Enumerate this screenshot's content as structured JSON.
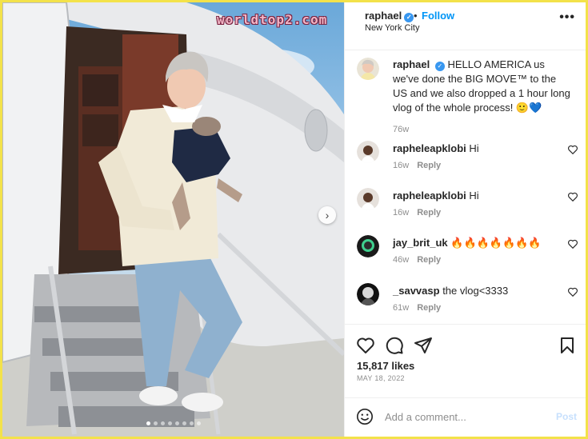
{
  "watermark": "worldtop2.com",
  "carousel": {
    "dot_count": 8,
    "active_index": 0
  },
  "post": {
    "username": "raphael",
    "follow_label": "Follow",
    "separator": "•",
    "location": "New York City",
    "more_label": "•••",
    "caption_username": "raphael",
    "caption_text": "HELLO AMERICA us we've done the BIG MOVE™ to the US and we also dropped a 1 hour long vlog of the whole process! 🙂💙",
    "caption_time": "76w",
    "likes": "15,817 likes",
    "date": "MAY 18, 2022"
  },
  "comments": [
    {
      "user": "rapheleapklobi",
      "text": "Hi",
      "time": "16w",
      "reply": "Reply"
    },
    {
      "user": "rapheleapklobi",
      "text": "Hi",
      "time": "16w",
      "reply": "Reply"
    },
    {
      "user": "jay_brit_uk",
      "text": "🔥🔥🔥🔥🔥🔥🔥",
      "time": "46w",
      "reply": "Reply"
    },
    {
      "user": "_savvasp",
      "text": "the vlog<3333",
      "time": "61w",
      "reply": "Reply"
    }
  ],
  "add_comment": {
    "placeholder": "Add a comment...",
    "post_label": "Post"
  },
  "icons": {
    "more": "more-horizontal-icon",
    "verified": "verified-badge-icon",
    "like": "heart-icon",
    "comment": "comment-icon",
    "share": "paper-plane-icon",
    "save": "bookmark-icon",
    "emoji": "emoji-smile-icon",
    "next": "chevron-right-icon"
  },
  "colors": {
    "accent": "#0095f6",
    "verified": "#3897f0",
    "frame": "#f3e24a"
  }
}
